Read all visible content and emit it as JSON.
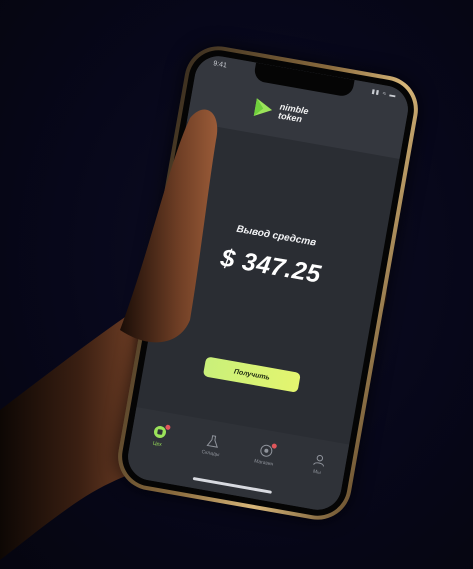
{
  "status_bar": {
    "time": "9:41",
    "icons": "▮▮ ≈ ▬"
  },
  "brand": {
    "line1": "nimble",
    "line2": "token",
    "accent": "#9be35a"
  },
  "main": {
    "title": "Вывод средств",
    "balance": "$ 347.25",
    "receive_label": "Получить"
  },
  "tabbar": {
    "items": [
      {
        "label": "Цех",
        "icon": "home-coin-icon",
        "active": true,
        "badge": true
      },
      {
        "label": "Склады",
        "icon": "flask-icon",
        "active": false,
        "badge": false
      },
      {
        "label": "Магазин",
        "icon": "shop-icon",
        "active": false,
        "badge": true
      },
      {
        "label": "Мы",
        "icon": "profile-icon",
        "active": false,
        "badge": false
      }
    ]
  },
  "colors": {
    "background": "#07071a",
    "screen": "#2a2d33",
    "header": "#34373e",
    "button": "#d4f275"
  }
}
